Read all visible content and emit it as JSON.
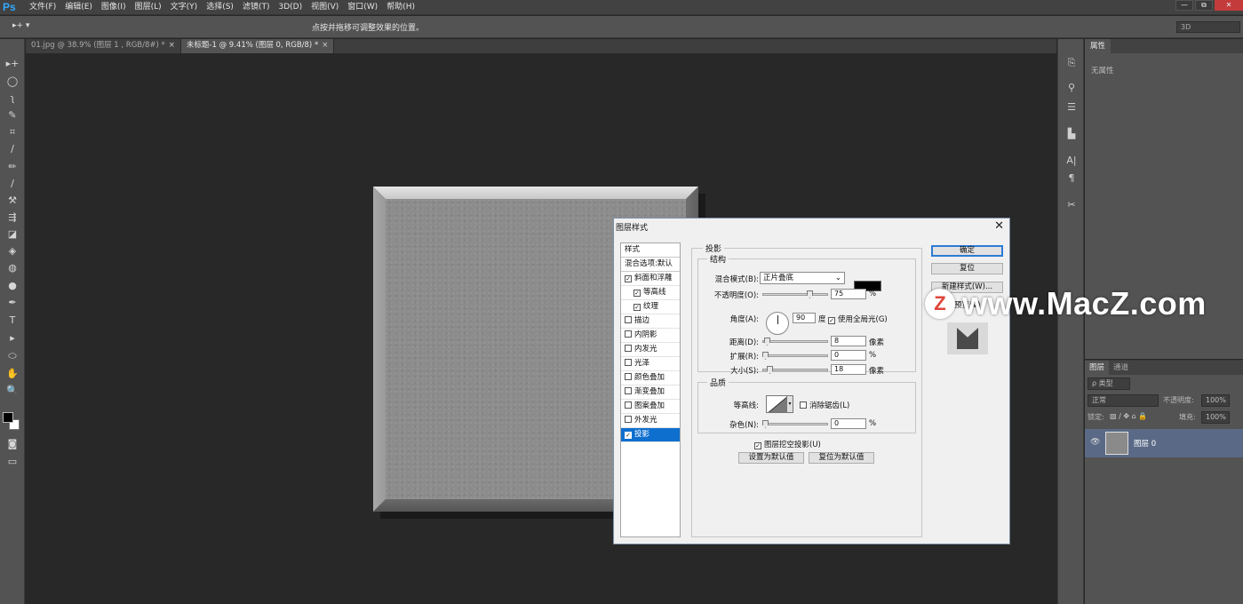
{
  "app": {
    "logo": "Ps",
    "menu": [
      "文件(F)",
      "编辑(E)",
      "图像(I)",
      "图层(L)",
      "文字(Y)",
      "选择(S)",
      "滤镜(T)",
      "3D(D)",
      "视图(V)",
      "窗口(W)",
      "帮助(H)"
    ],
    "window_controls": [
      "—",
      "⧉",
      "✕"
    ]
  },
  "options_bar": {
    "tool_indicator": "▸+ ▾",
    "hint": "点按并拖移可调整效果的位置。",
    "workspace_value": "3D"
  },
  "tabs": [
    {
      "label": "01.jpg @ 38.9% (图层 1 , RGB/8#) *",
      "close": "×",
      "active": false
    },
    {
      "label": "未标题-1 @ 9.41% (图层 0, RGB/8) *",
      "close": "×",
      "active": true
    }
  ],
  "tools": [
    "move-icon",
    "lasso-icon",
    "quick-select-icon",
    "crop-icon",
    "eyedropper-icon",
    "brush-icon",
    "stamp-icon",
    "history-brush-icon",
    "eraser-icon",
    "paint-bucket-icon",
    "blur-icon",
    "dodge-icon",
    "pen-icon",
    "text-icon",
    "path-select-icon",
    "shape-icon",
    "hand-icon",
    "zoom-icon"
  ],
  "tool_glyphs": [
    "▸+",
    "◯",
    "ʅ",
    "✎",
    "⌗",
    "∕",
    "✏",
    "⚒",
    "⇶",
    "◪",
    "◈",
    "◍",
    "●",
    "✒",
    "T",
    "▸",
    "⬭",
    "✋",
    "🔍"
  ],
  "colors": {
    "foreground": "#000000",
    "background": "#ffffff",
    "accent": "#0f6fcf",
    "layer_selected": "#5a6a86"
  },
  "properties_panel": {
    "tab": "属性",
    "empty_text": "无属性"
  },
  "layers_panel": {
    "tabs": [
      "图层",
      "通道"
    ],
    "filter_type": "ρ 类型",
    "blend_mode": "正常",
    "opacity_label": "不透明度:",
    "opacity_value": "100%",
    "lock_label": "锁定:",
    "fill_label": "填充:",
    "fill_value": "100%",
    "layer_name": "图层 0"
  },
  "dialog": {
    "title": "图层样式",
    "close": "✕",
    "styles": [
      {
        "label": "样式",
        "type": "header"
      },
      {
        "label": "混合选项:默认",
        "type": "header"
      },
      {
        "label": "斜面和浮雕",
        "checked": true,
        "type": "item"
      },
      {
        "label": "等高线",
        "checked": true,
        "type": "sub"
      },
      {
        "label": "纹理",
        "checked": true,
        "type": "sub"
      },
      {
        "label": "描边",
        "checked": false,
        "type": "item"
      },
      {
        "label": "内阴影",
        "checked": false,
        "type": "item"
      },
      {
        "label": "内发光",
        "checked": false,
        "type": "item"
      },
      {
        "label": "光泽",
        "checked": false,
        "type": "item"
      },
      {
        "label": "颜色叠加",
        "checked": false,
        "type": "item"
      },
      {
        "label": "渐变叠加",
        "checked": false,
        "type": "item"
      },
      {
        "label": "图案叠加",
        "checked": false,
        "type": "item"
      },
      {
        "label": "外发光",
        "checked": false,
        "type": "item"
      },
      {
        "label": "投影",
        "checked": true,
        "type": "item",
        "selected": true
      }
    ],
    "section_title": "投影",
    "structure": {
      "title": "结构",
      "blend_mode_label": "混合模式(B):",
      "blend_mode_value": "正片叠底",
      "opacity_label": "不透明度(O):",
      "opacity_value": "75",
      "opacity_fraction": 0.75,
      "angle_label": "角度(A):",
      "angle_value": "90",
      "angle_unit": "度",
      "global_light_label": "使用全局光(G)",
      "global_light_checked": true,
      "distance_label": "距离(D):",
      "distance_value": "8",
      "distance_fraction": 0.03,
      "spread_label": "扩展(R):",
      "spread_value": "0",
      "spread_fraction": 0.0,
      "size_label": "大小(S):",
      "size_value": "18",
      "size_fraction": 0.07,
      "pixel_unit": "像素",
      "percent_unit": "%",
      "shadow_color": "#000000"
    },
    "quality": {
      "title": "品质",
      "contour_label": "等高线:",
      "antialias_label": "消除锯齿(L)",
      "antialias_checked": false,
      "noise_label": "杂色(N):",
      "noise_value": "0",
      "noise_fraction": 0.0
    },
    "knockout_label": "图层挖空投影(U)",
    "knockout_checked": true,
    "make_default": "设置为默认值",
    "reset_default": "复位为默认值",
    "buttons": {
      "ok": "确定",
      "reset": "复位",
      "new_style": "新建样式(W)...",
      "preview": "预览(V)"
    },
    "preview_checked": true
  },
  "watermark": {
    "logo": "Z",
    "text": "www.MacZ.com"
  }
}
